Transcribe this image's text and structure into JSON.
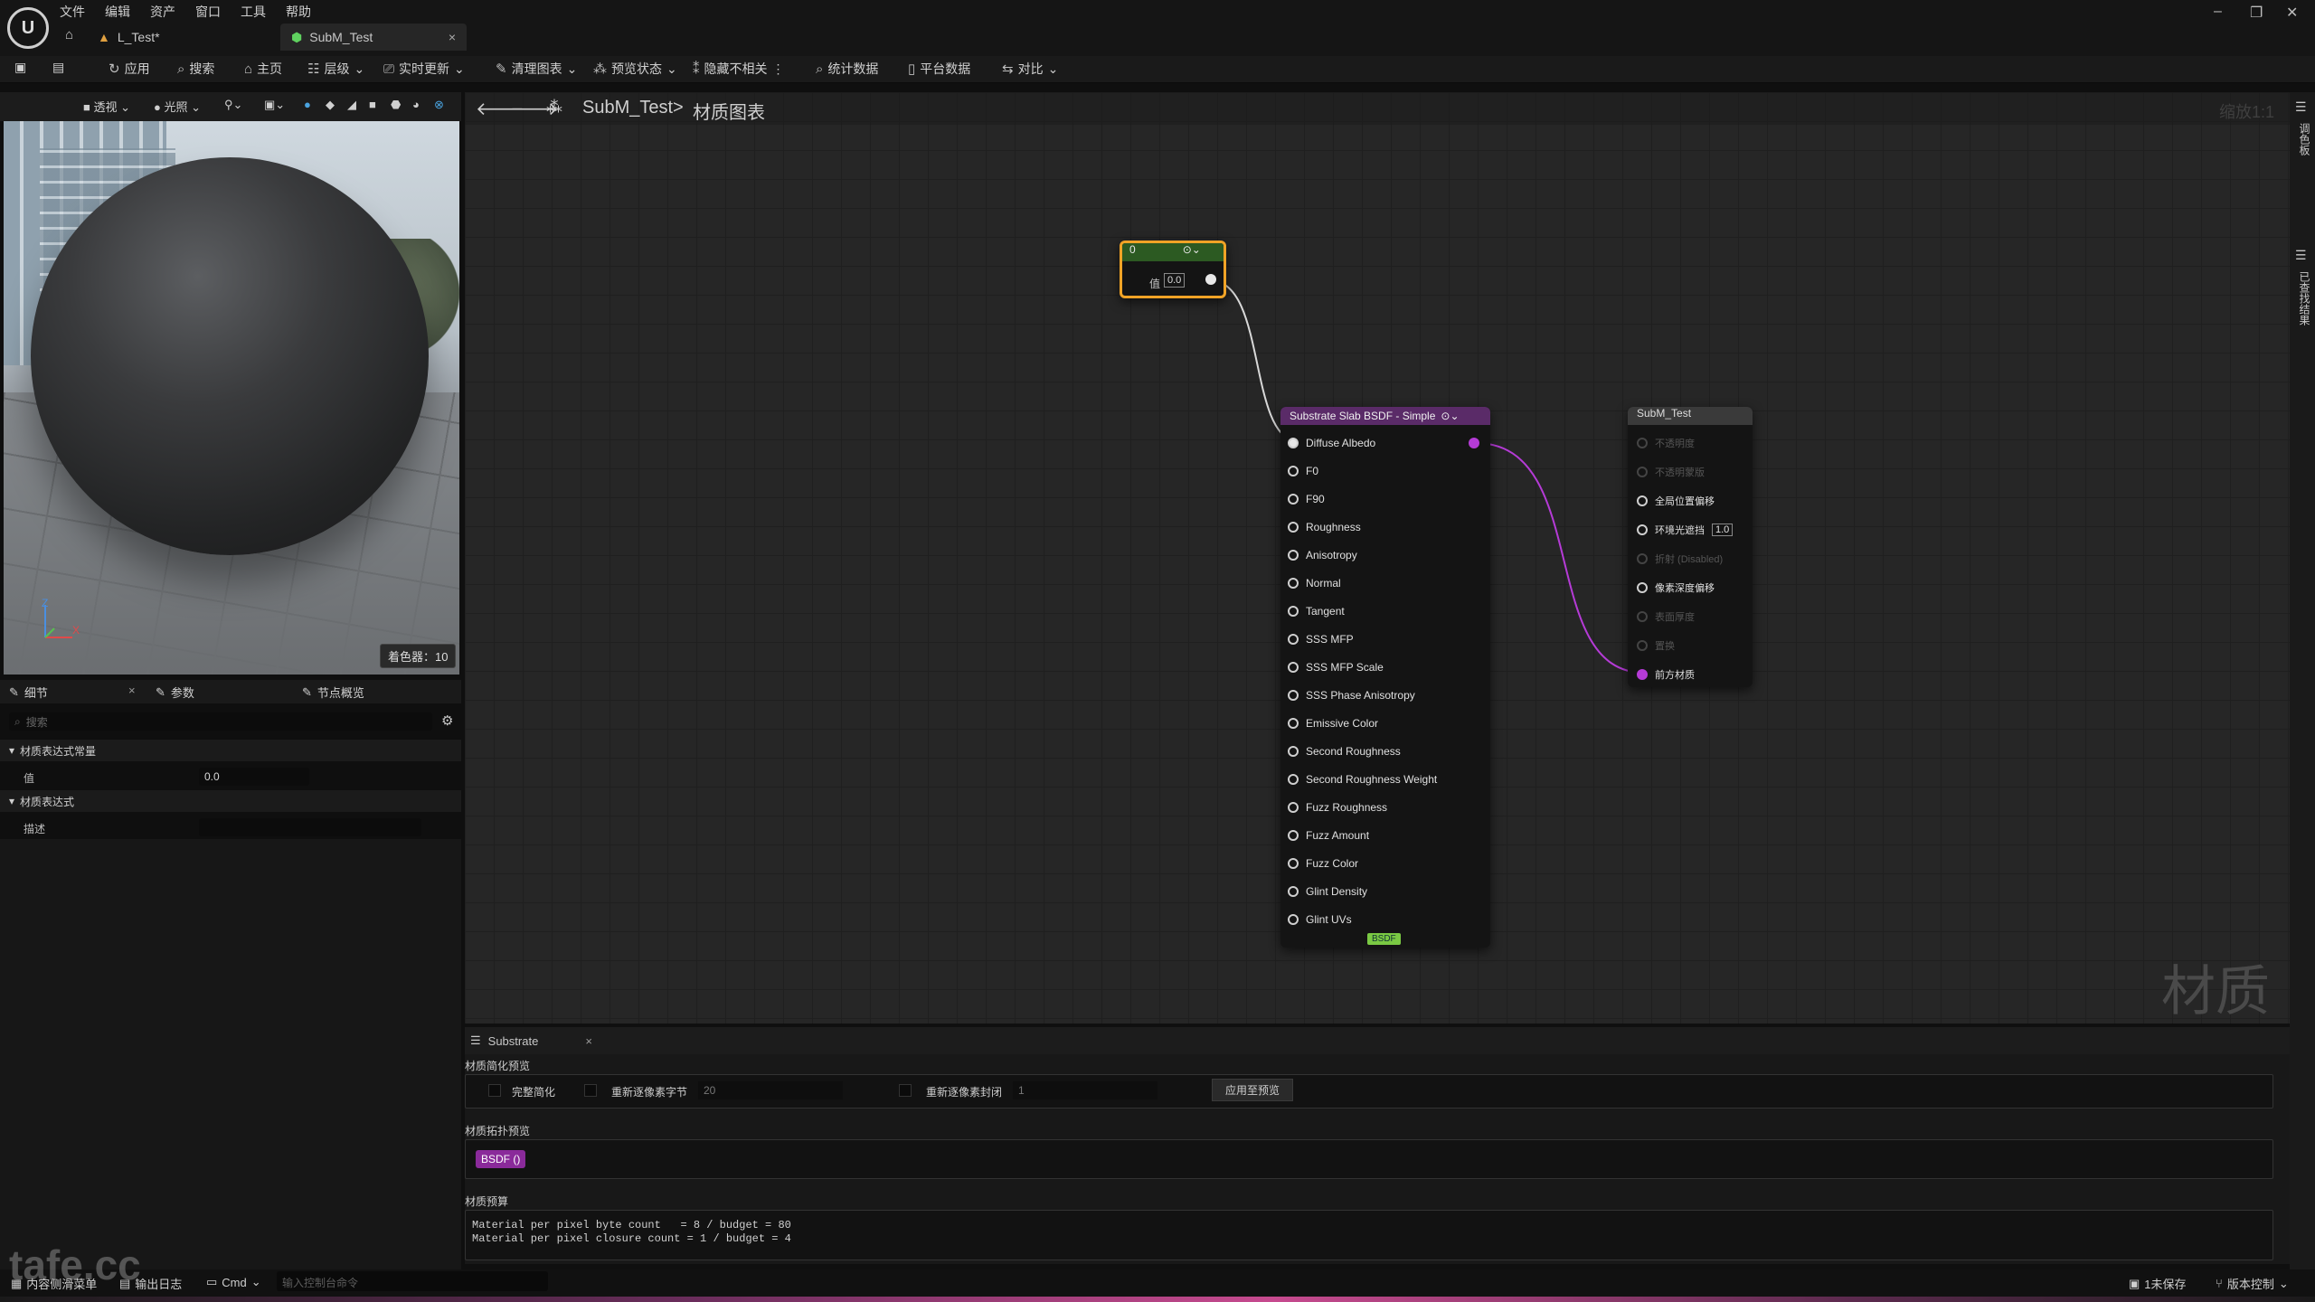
{
  "menu": [
    "文件",
    "编辑",
    "资产",
    "窗口",
    "工具",
    "帮助"
  ],
  "tabs": {
    "level": "L_Test*",
    "material": "SubM_Test"
  },
  "toolbar": {
    "apply": "应用",
    "search": "搜索",
    "home": "主页",
    "hierarchy": "层级",
    "live_update": "实时更新",
    "clean_graph": "清理图表",
    "preview_state": "预览状态",
    "hide_unrelated": "隐藏不相关",
    "stats": "统计数据",
    "platform_stats": "平台数据",
    "compare": "对比"
  },
  "viewport": {
    "perspective": "透视",
    "lit": "光照",
    "shader_count": "着色器：10",
    "axis_x": "X",
    "axis_z": "Z"
  },
  "details": {
    "tab_details": "细节",
    "tab_params": "参数",
    "tab_node_overview": "节点概览",
    "search_placeholder": "搜索",
    "section_constant": "材质表达式常量",
    "value_label": "值",
    "value": "0.0",
    "section_expression": "材质表达式",
    "desc_label": "描述",
    "desc_value": ""
  },
  "graph": {
    "breadcrumb_root": "SubM_Test",
    "breadcrumb_sep": ">",
    "breadcrumb_leaf": "材质图表",
    "zoom": "缩放1:1",
    "watermark": "材质",
    "right_tab1": "调色板",
    "right_tab2": "已查找结果"
  },
  "const_node": {
    "title": "0",
    "value_label": "值",
    "value": "0.0"
  },
  "bsdf_node": {
    "title": "Substrate Slab BSDF - Simple",
    "footer": "BSDF",
    "pins": [
      "Diffuse Albedo",
      "F0",
      "F90",
      "Roughness",
      "Anisotropy",
      "Normal",
      "Tangent",
      "SSS MFP",
      "SSS MFP Scale",
      "SSS Phase Anisotropy",
      "Emissive Color",
      "Second Roughness",
      "Second Roughness Weight",
      "Fuzz Roughness",
      "Fuzz Amount",
      "Fuzz Color",
      "Glint Density",
      "Glint UVs"
    ]
  },
  "output_node": {
    "title": "SubM_Test",
    "rows": [
      {
        "label": "不透明度",
        "enabled": false
      },
      {
        "label": "不透明蒙版",
        "enabled": false
      },
      {
        "label": "全局位置偏移",
        "enabled": true
      },
      {
        "label": "环境光遮挡",
        "enabled": true,
        "value": "1.0"
      },
      {
        "label": "折射 (Disabled)",
        "enabled": false
      },
      {
        "label": "像素深度偏移",
        "enabled": true
      },
      {
        "label": "表面厚度",
        "enabled": false
      },
      {
        "label": "置换",
        "enabled": false
      },
      {
        "label": "前方材质",
        "enabled": true,
        "accent": true
      }
    ]
  },
  "substrate_panel": {
    "tab": "Substrate",
    "simplify_title": "材质简化预览",
    "full_simplify": "完整简化",
    "bytes_label": "重新逐像素字节",
    "bytes_value": "20",
    "closure_label": "重新逐像素封闭",
    "closure_value": "1",
    "apply_preview": "应用至预览",
    "topology_title": "材质拓扑预览",
    "topology_chip": "BSDF ()",
    "budget_title": "材质预算",
    "budget_lines": [
      "Material per pixel byte count   = 8 / budget = 80",
      "Material per pixel closure count = 1 / budget = 4"
    ]
  },
  "statusbar": {
    "content_drawer": "内容侧滑菜单",
    "output_log": "输出日志",
    "cmd": "Cmd",
    "cmd_placeholder": "输入控制台命令",
    "unsaved": "1未保存",
    "source_control": "版本控制",
    "watermark": "tafe.cc"
  },
  "colors": {
    "accent_orange": "#f0a326",
    "const_green": "#2c5a22",
    "bsdf_purple": "#5a2b68",
    "wire_pink": "#b53bd6"
  }
}
